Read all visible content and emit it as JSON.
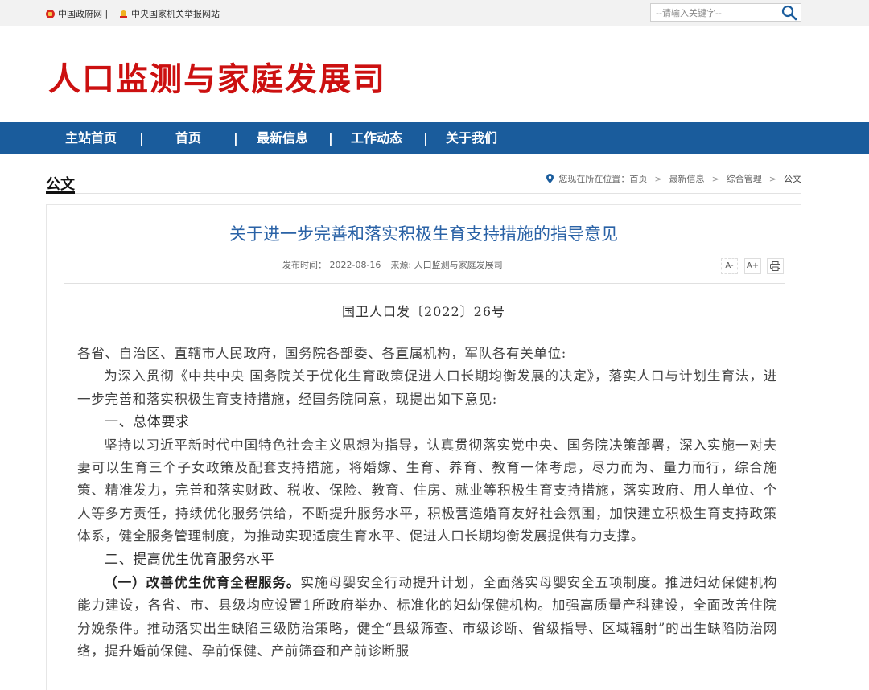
{
  "topbar": {
    "links": [
      "中国政府网 |",
      "中央国家机关举报网站"
    ],
    "search_placeholder": "--请输入关键字--"
  },
  "header": {
    "logo_text": "人口监测与家庭发展司"
  },
  "nav": {
    "items": [
      "主站首页",
      "首页",
      "最新信息",
      "工作动态",
      "关于我们"
    ],
    "separator": "|"
  },
  "section": {
    "title": "公文"
  },
  "breadcrumb": {
    "prefix": "您现在所在位置：",
    "items": [
      "首页",
      "最新信息",
      "综合管理",
      "公文"
    ],
    "separator": ">"
  },
  "article": {
    "title": "关于进一步完善和落实积极生育支持措施的指导意见",
    "publish_time": "发布时间： 2022-08-16",
    "source": "来源: 人口监测与家庭发展司",
    "tools": [
      "A-",
      "A+",
      "print"
    ],
    "doc_number": "国卫人口发〔2022〕26号",
    "paragraphs": {
      "p1": "各省、自治区、直辖市人民政府，国务院各部委、各直属机构，军队各有关单位:",
      "p2": "为深入贯彻《中共中央 国务院关于优化生育政策促进人口长期均衡发展的决定》，落实人口与计划生育法，进一步完善和落实积极生育支持措施，经国务院同意，现提出如下意见:",
      "h1": "一、总体要求",
      "p3": "坚持以习近平新时代中国特色社会主义思想为指导，认真贯彻落实党中央、国务院决策部署，深入实施一对夫妻可以生育三个子女政策及配套支持措施，将婚嫁、生育、养育、教育一体考虑，尽力而为、量力而行，综合施策、精准发力，完善和落实财政、税收、保险、教育、住房、就业等积极生育支持措施，落实政府、用人单位、个人等多方责任，持续优化服务供给，不断提升服务水平，积极营造婚育友好社会氛围，加快建立积极生育支持政策体系，健全服务管理制度，为推动实现适度生育水平、促进人口长期均衡发展提供有力支撑。",
      "h2": "二、提高优生优育服务水平",
      "p4_lead": "（一）改善优生优育全程服务。",
      "p4_rest": "实施母婴安全行动提升计划，全面落实母婴安全五项制度。推进妇幼保健机构能力建设，各省、市、县级均应设置1所政府举办、标准化的妇幼保健机构。加强高质量产科建设，全面改善住院分娩条件。推动落实出生缺陷三级防治策略，健全“县级筛查、市级诊断、省级指导、区域辐射”的出生缺陷防治网络，提升婚前保健、孕前保健、产前筛查和产前诊断服"
    }
  },
  "colors": {
    "nav_bg": "#1a5c9c",
    "logo": "#cc1010",
    "title": "#2a62a6"
  }
}
